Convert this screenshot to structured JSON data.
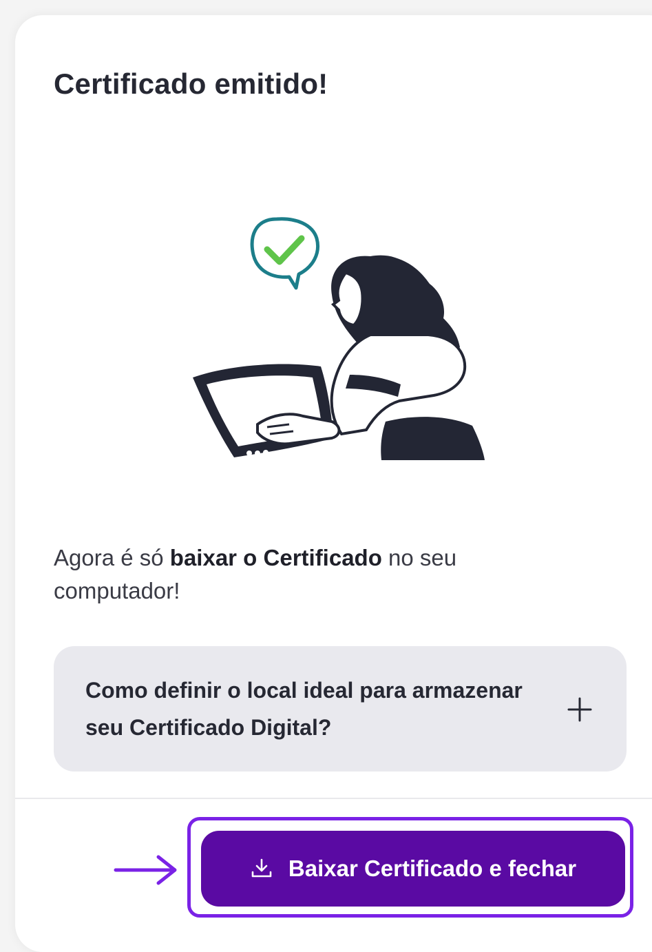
{
  "dialog": {
    "title": "Certificado emitido!",
    "illustration_icon": "woman-at-laptop-checkmark-illustration",
    "description": {
      "prefix": "Agora é só ",
      "bold": "baixar o Certificado",
      "suffix": " no seu computador!"
    },
    "accordion": {
      "question": "Como definir o local ideal para armazenar seu Certificado Digital?",
      "toggle_icon": "plus-icon"
    },
    "primary_button": {
      "label": "Baixar Certificado e fechar",
      "icon": "download-icon"
    },
    "annotation": {
      "arrow_icon": "arrow-right-icon",
      "highlight_color": "#7a22e6"
    }
  },
  "colors": {
    "primary": "#5a0aa3",
    "accordion_bg": "#e9e9ee",
    "text": "#262833",
    "check": "#5fc44a",
    "bubble": "#1c7e8a"
  }
}
